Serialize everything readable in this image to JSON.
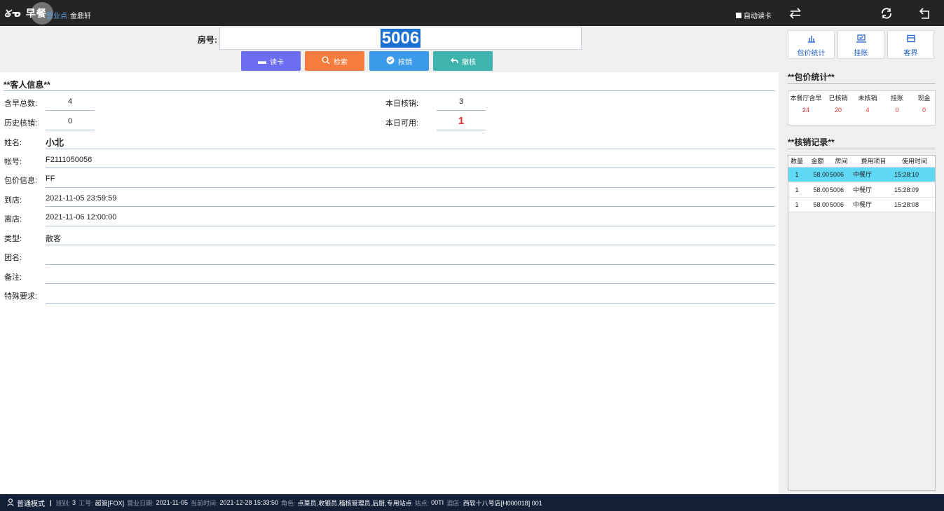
{
  "topbar": {
    "app_title": "早餐",
    "outlet_label": "营业点:",
    "outlet_name": "金鼎轩",
    "auto_read_label": "自动读卡"
  },
  "search": {
    "room_label": "房号:",
    "room_value": "5006",
    "buttons": {
      "read_card": "读卡",
      "search": "检索",
      "verify": "核销",
      "revoke": "撤核"
    }
  },
  "guest": {
    "section_title": "**客人信息**",
    "total_breakfast_label": "含早总数:",
    "total_breakfast_value": "4",
    "history_verified_label": "历史核销:",
    "history_verified_value": "0",
    "today_verified_label": "本日核销:",
    "today_verified_value": "3",
    "today_available_label": "本日可用:",
    "today_available_value": "1",
    "name_label": "姓名:",
    "name_value": "小北",
    "account_label": "帐号:",
    "account_value": "F2111050056",
    "package_label": "包价信息:",
    "package_value": "FF",
    "arrival_label": "到店:",
    "arrival_value": "2021-11-05 23:59:59",
    "departure_label": "离店:",
    "departure_value": "2021-11-06 12:00:00",
    "type_label": "类型:",
    "type_value": "散客",
    "group_label": "团名:",
    "group_value": "",
    "remark_label": "备注:",
    "remark_value": "",
    "special_label": "特殊要求:",
    "special_value": ""
  },
  "right_panel": {
    "buttons": {
      "package_stats": "包价统计",
      "charge": "挂账",
      "guest_world": "客界"
    },
    "stats_title": "**包价统计**",
    "stats_headers": [
      "本餐厅含早",
      "已核销",
      "未核销",
      "挂账",
      "现金"
    ],
    "stats_values": [
      "24",
      "20",
      "4",
      "0",
      "0"
    ],
    "records_title": "**核销记录**",
    "records_headers": [
      "数量",
      "金额",
      "房间",
      "费用项目",
      "使用时间"
    ],
    "records": [
      {
        "qty": "1",
        "amount": "58.00",
        "room": "5006",
        "item": "中餐厅",
        "time": "15:28:10"
      },
      {
        "qty": "1",
        "amount": "58.00",
        "room": "5006",
        "item": "中餐厅",
        "time": "15:28:09"
      },
      {
        "qty": "1",
        "amount": "58.00",
        "room": "5006",
        "item": "中餐厅",
        "time": "15:28:08"
      }
    ]
  },
  "statusbar": {
    "mode": "普通模式",
    "shift_label": "班别:",
    "shift_value": "3",
    "staff_label": "工号:",
    "staff_value": "超管[FOX]",
    "business_date_label": "营业日期:",
    "business_date_value": "2021-11-05",
    "current_time_label": "当前时间:",
    "current_time_value": "2021-12-28 15:33:50",
    "role_label": "角色:",
    "role_value": "点菜员,收银员,稽核管理员,后厨,专用站点",
    "station_label": "站点:",
    "station_value": "00TI",
    "hotel_label": "酒店:",
    "hotel_value": "西软十八号店[H000018] 001"
  },
  "colors": {
    "read_card": "#6c6df0",
    "search": "#f57c3c",
    "verify": "#3b9bea",
    "revoke": "#3fb3ad",
    "selected_row": "#5fd8f5",
    "highlight_red": "#e0312e"
  }
}
